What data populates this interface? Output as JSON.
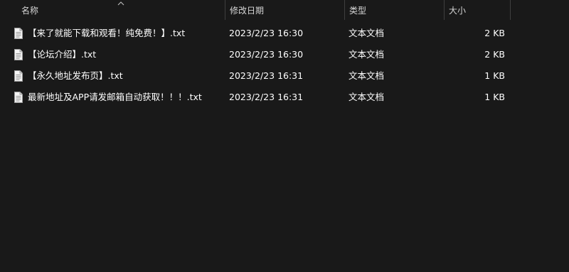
{
  "columns": {
    "name": "名称",
    "date": "修改日期",
    "type": "类型",
    "size": "大小"
  },
  "sort": {
    "column": "name",
    "icon": "sort-ascending-chevron-icon"
  },
  "files": [
    {
      "icon": "text-file-icon",
      "name": "【来了就能下载和观看！纯免费！】.txt",
      "date": "2023/2/23 16:30",
      "type": "文本文档",
      "size": "2 KB"
    },
    {
      "icon": "text-file-icon",
      "name": "【论坛介绍】.txt",
      "date": "2023/2/23 16:30",
      "type": "文本文档",
      "size": "2 KB"
    },
    {
      "icon": "text-file-icon",
      "name": "【永久地址发布页】.txt",
      "date": "2023/2/23 16:31",
      "type": "文本文档",
      "size": "1 KB"
    },
    {
      "icon": "text-file-icon",
      "name": "最新地址及APP请发邮箱自动获取！！！.txt",
      "date": "2023/2/23 16:31",
      "type": "文本文档",
      "size": "1 KB"
    }
  ],
  "colors": {
    "background": "#191919",
    "text": "#ffffff",
    "header_text": "#d6d6d6",
    "separator": "#3f3f3f"
  }
}
